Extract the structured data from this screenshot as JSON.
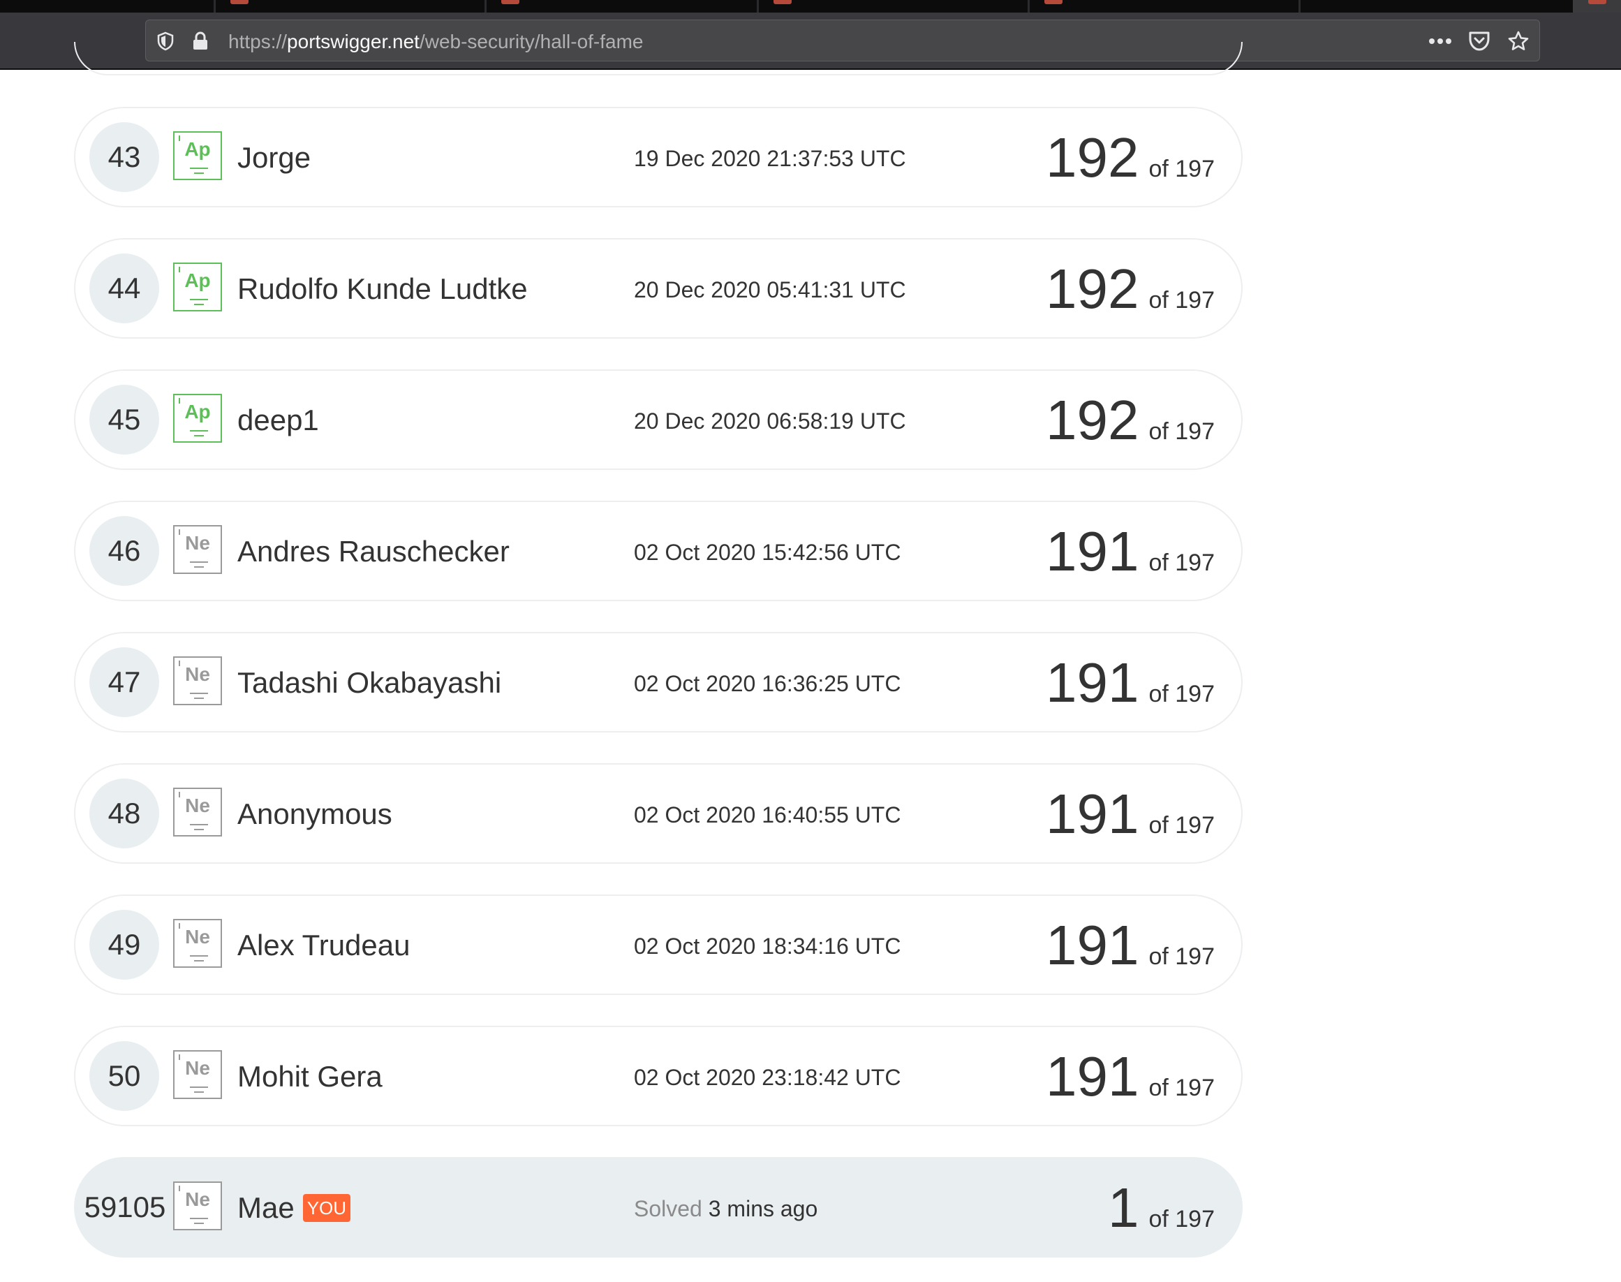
{
  "browser": {
    "url_scheme": "https://",
    "url_host": "portswigger.net",
    "url_path": "/web-security/hall-of-fame"
  },
  "leaderboard": {
    "rows": [
      {
        "rank": "43",
        "level": "Ap",
        "level_type": "ap",
        "name": "Jorge",
        "date": "19 Dec 2020 21:37:53 UTC",
        "score": "192",
        "total": "of 197"
      },
      {
        "rank": "44",
        "level": "Ap",
        "level_type": "ap",
        "name": "Rudolfo Kunde Ludtke",
        "date": "20 Dec 2020 05:41:31 UTC",
        "score": "192",
        "total": "of 197"
      },
      {
        "rank": "45",
        "level": "Ap",
        "level_type": "ap",
        "name": "deep1",
        "date": "20 Dec 2020 06:58:19 UTC",
        "score": "192",
        "total": "of 197"
      },
      {
        "rank": "46",
        "level": "Ne",
        "level_type": "ne",
        "name": "Andres Rauschecker",
        "date": "02 Oct 2020 15:42:56 UTC",
        "score": "191",
        "total": "of 197"
      },
      {
        "rank": "47",
        "level": "Ne",
        "level_type": "ne",
        "name": "Tadashi Okabayashi",
        "date": "02 Oct 2020 16:36:25 UTC",
        "score": "191",
        "total": "of 197"
      },
      {
        "rank": "48",
        "level": "Ne",
        "level_type": "ne",
        "name": "Anonymous",
        "date": "02 Oct 2020 16:40:55 UTC",
        "score": "191",
        "total": "of 197"
      },
      {
        "rank": "49",
        "level": "Ne",
        "level_type": "ne",
        "name": "Alex Trudeau",
        "date": "02 Oct 2020 18:34:16 UTC",
        "score": "191",
        "total": "of 197"
      },
      {
        "rank": "50",
        "level": "Ne",
        "level_type": "ne",
        "name": "Mohit Gera",
        "date": "02 Oct 2020 23:18:42 UTC",
        "score": "191",
        "total": "of 197"
      }
    ],
    "current_user": {
      "rank": "59105",
      "level": "Ne",
      "name": "Mae",
      "badge": "YOU",
      "solved_label": "Solved",
      "solved_time": "3 mins ago",
      "score": "1",
      "total": "of 197"
    }
  },
  "colors": {
    "apprentice": "#5dbf57",
    "newcomer": "#9a9a9a",
    "you_badge": "#ff6633",
    "rank_bubble": "#e9eef1"
  },
  "icons": [
    "shield-icon",
    "lock-icon",
    "more-icon",
    "pocket-icon",
    "star-icon"
  ]
}
